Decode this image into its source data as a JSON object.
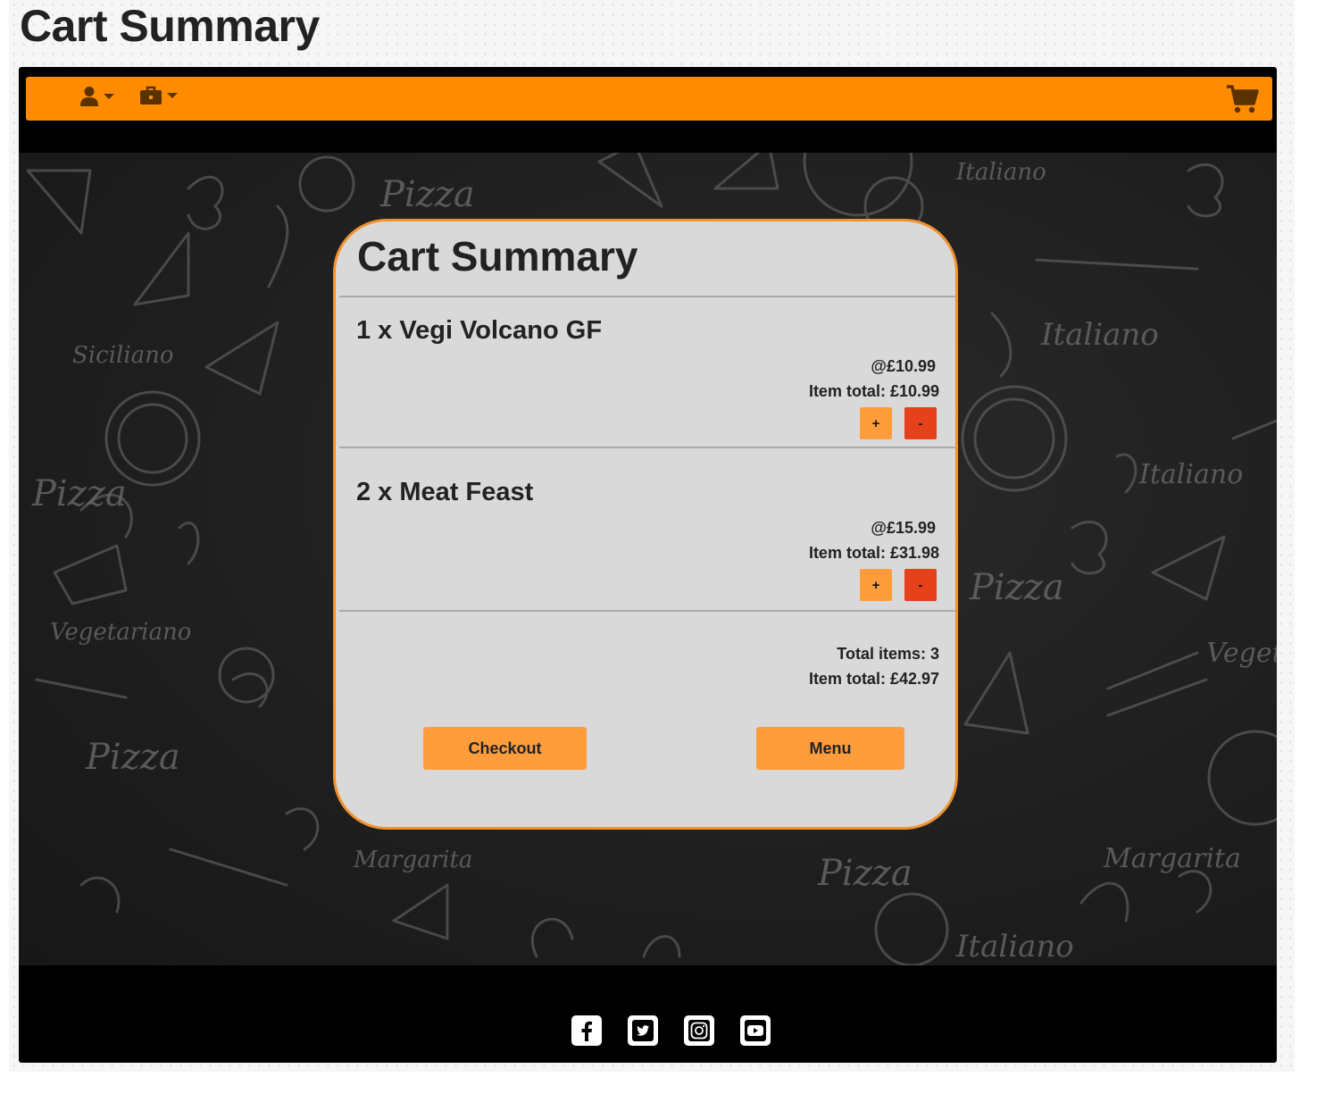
{
  "page": {
    "heading": "Cart Summary"
  },
  "navbar": {
    "icons": [
      "user-icon",
      "briefcase-icon",
      "cart-icon"
    ],
    "accent_color": "#ff8c00"
  },
  "cart": {
    "title": "Cart Summary",
    "items": [
      {
        "name": "1 x Vegi Volcano GF",
        "unit_price": "@£10.99",
        "item_total": "Item total: £10.99",
        "plus_label": "+",
        "minus_label": "-"
      },
      {
        "name": "2 x Meat Feast",
        "unit_price": "@£15.99",
        "item_total": "Item total: £31.98",
        "plus_label": "+",
        "minus_label": "-"
      }
    ],
    "summary": {
      "total_items": "Total items: 3",
      "item_total": "Item total: £42.97"
    },
    "buttons": {
      "checkout": "Checkout",
      "menu": "Menu"
    },
    "border_color": "#f0922f",
    "plus_color": "#ff9d3d",
    "minus_color": "#e7411b"
  },
  "footer": {
    "social_icons": [
      "facebook-icon",
      "twitter-icon",
      "instagram-icon",
      "youtube-icon"
    ]
  }
}
